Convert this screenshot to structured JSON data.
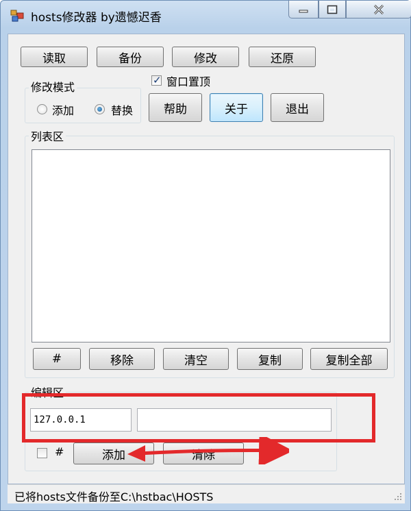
{
  "window": {
    "title": "hosts修改器 by遗憾迟香"
  },
  "toolbar": {
    "read_label": "读取",
    "backup_label": "备份",
    "modify_label": "修改",
    "restore_label": "还原"
  },
  "mode_group": {
    "title": "修改模式",
    "options": [
      {
        "label": "添加",
        "checked": false
      },
      {
        "label": "替换",
        "checked": true
      }
    ]
  },
  "topmost": {
    "label": "窗口置顶",
    "checked": true
  },
  "actions": {
    "help_label": "帮助",
    "about_label": "关于",
    "exit_label": "退出"
  },
  "list_group": {
    "title": "列表区",
    "items": [],
    "buttons": {
      "hash_label": "#",
      "remove_label": "移除",
      "clear_label": "清空",
      "copy_label": "复制",
      "copy_all_label": "复制全部"
    }
  },
  "edit_group": {
    "title": "编辑区",
    "ip_value": "127.0.0.1",
    "host_value": "",
    "hash_checkbox_label": "#",
    "hash_checked": false,
    "add_label": "添加",
    "clear_label": "清除"
  },
  "status": {
    "text": "已将hosts文件备份至C:\\hstbac\\HOSTS"
  },
  "colors": {
    "annotation": "#e3292b",
    "focus_border": "#3c7fb1"
  }
}
